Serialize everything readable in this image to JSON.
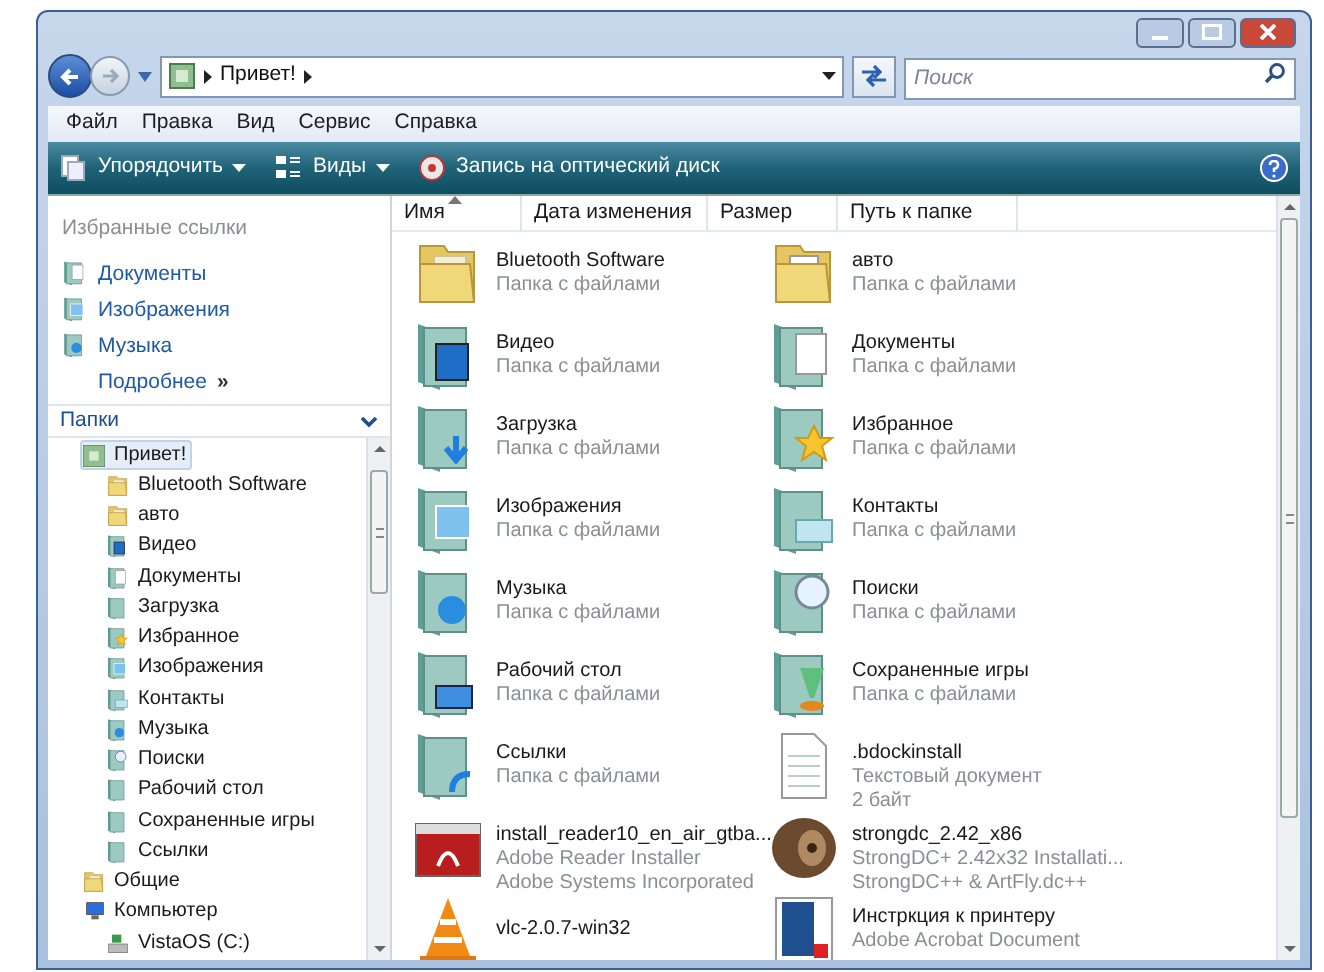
{
  "nav": {
    "breadcrumb": [
      "Привет!"
    ],
    "search": {
      "placeholder": "Поиск"
    }
  },
  "menu": [
    "Файл",
    "Правка",
    "Вид",
    "Сервис",
    "Справка"
  ],
  "toolbar": [
    {
      "label": "Упорядочить",
      "kind": "organize",
      "dropdown": true
    },
    {
      "label": "Виды",
      "kind": "views",
      "dropdown": true
    },
    {
      "label": "Запись на оптический диск",
      "kind": "burn",
      "dropdown": false
    }
  ],
  "favorites": {
    "title": "Избранные ссылки",
    "items": [
      {
        "label": "Документы",
        "kind": "documents"
      },
      {
        "label": "Изображения",
        "kind": "pictures"
      },
      {
        "label": "Музыка",
        "kind": "music"
      }
    ],
    "more": {
      "label": "Подробнее",
      "glyph": "»"
    }
  },
  "folders": {
    "title": "Папки",
    "tree": [
      {
        "label": "Привет!",
        "kind": "user",
        "selected": true,
        "children": [
          {
            "label": "Bluetooth Software",
            "kind": "folder",
            "selected": false
          },
          {
            "label": "авто",
            "kind": "folder",
            "selected": false
          },
          {
            "label": "Видео",
            "kind": "video",
            "selected": false
          },
          {
            "label": "Документы",
            "kind": "documents",
            "selected": false
          },
          {
            "label": "Загрузка",
            "kind": "library",
            "selected": false
          },
          {
            "label": "Избранное",
            "kind": "star",
            "selected": false
          },
          {
            "label": "Изображения",
            "kind": "pictures",
            "selected": false
          },
          {
            "label": "Контакты",
            "kind": "contacts",
            "selected": false
          },
          {
            "label": "Музыка",
            "kind": "music",
            "selected": false
          },
          {
            "label": "Поиски",
            "kind": "search",
            "selected": false
          },
          {
            "label": "Рабочий стол",
            "kind": "library",
            "selected": false
          },
          {
            "label": "Сохраненные игры",
            "kind": "library",
            "selected": false
          },
          {
            "label": "Ссылки",
            "kind": "library",
            "selected": false
          }
        ]
      },
      {
        "label": "Общие",
        "kind": "folder",
        "selected": false
      },
      {
        "label": "Компьютер",
        "kind": "computer",
        "selected": false,
        "children": [
          {
            "label": "VistaOS (C:)",
            "kind": "drive",
            "selected": false
          }
        ]
      }
    ]
  },
  "columns": [
    {
      "label": "Имя",
      "sorted": true
    },
    {
      "label": "Дата изменения",
      "sorted": false
    },
    {
      "label": "Размер",
      "sorted": false
    },
    {
      "label": "Путь к папке",
      "sorted": false
    }
  ],
  "files": [
    {
      "name": "Bluetooth Software",
      "details": [
        "Папка с файлами"
      ],
      "kind": "folder"
    },
    {
      "name": "авто",
      "details": [
        "Папка с файлами"
      ],
      "kind": "folder-docs"
    },
    {
      "name": "Видео",
      "details": [
        "Папка с файлами"
      ],
      "kind": "video"
    },
    {
      "name": "Документы",
      "details": [
        "Папка с файлами"
      ],
      "kind": "documents"
    },
    {
      "name": "Загрузка",
      "details": [
        "Папка с файлами"
      ],
      "kind": "download"
    },
    {
      "name": "Избранное",
      "details": [
        "Папка с файлами"
      ],
      "kind": "star"
    },
    {
      "name": "Изображения",
      "details": [
        "Папка с файлами"
      ],
      "kind": "pictures"
    },
    {
      "name": "Контакты",
      "details": [
        "Папка с файлами"
      ],
      "kind": "contacts"
    },
    {
      "name": "Музыка",
      "details": [
        "Папка с файлами"
      ],
      "kind": "music"
    },
    {
      "name": "Поиски",
      "details": [
        "Папка с файлами"
      ],
      "kind": "search"
    },
    {
      "name": "Рабочий стол",
      "details": [
        "Папка с файлами"
      ],
      "kind": "desktop"
    },
    {
      "name": "Сохраненные игры",
      "details": [
        "Папка с файлами"
      ],
      "kind": "games"
    },
    {
      "name": "Ссылки",
      "details": [
        "Папка с файлами"
      ],
      "kind": "links"
    },
    {
      "name": ".bdockinstall",
      "details": [
        "Текстовый документ",
        "2 байт"
      ],
      "kind": "text"
    },
    {
      "name": "install_reader10_en_air_gtba...",
      "details": [
        "Adobe Reader Installer",
        "Adobe Systems Incorporated"
      ],
      "kind": "installer"
    },
    {
      "name": "strongdc_2.42_x86",
      "details": [
        "StrongDC+ 2.42x32 Installati...",
        "StrongDC++ & ArtFly.dc++"
      ],
      "kind": "reel"
    },
    {
      "name": "vlc-2.0.7-win32",
      "kind": "cone"
    },
    {
      "name": "Инстркция к принтеру",
      "details": [
        "Adobe Acrobat Document"
      ],
      "kind": "pdf"
    }
  ]
}
